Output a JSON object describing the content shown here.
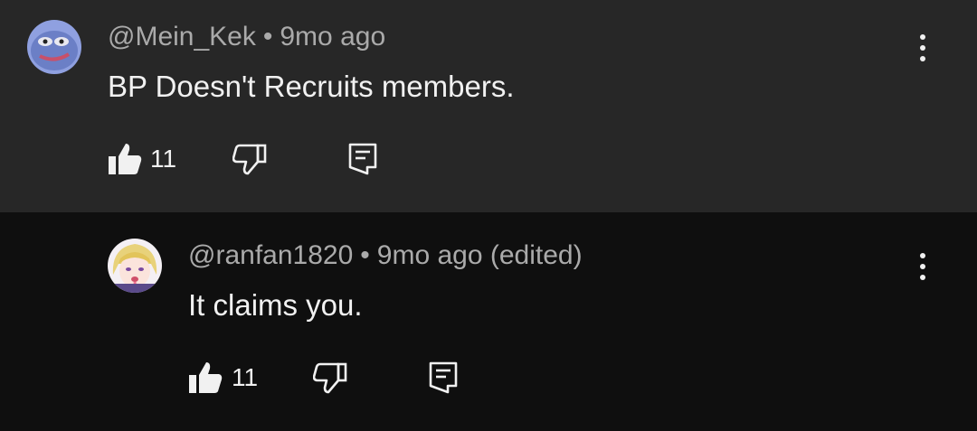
{
  "comments": [
    {
      "handle": "@Mein_Kek",
      "age": "9mo ago",
      "text": "BP Doesn't Recruits members.",
      "likes": "11"
    },
    {
      "handle": "@ranfan1820",
      "age": "9mo ago (edited)",
      "text": "It claims you.",
      "likes": "11"
    }
  ],
  "icons": {
    "like": "thumb-up-icon",
    "dislike": "thumb-down-icon",
    "reply": "reply-icon",
    "menu": "more-vert-icon"
  },
  "colors": {
    "top_bg": "#272727",
    "reply_bg": "#0f0f0f",
    "meta": "#aaaaaa",
    "text": "#f1f1f1"
  }
}
